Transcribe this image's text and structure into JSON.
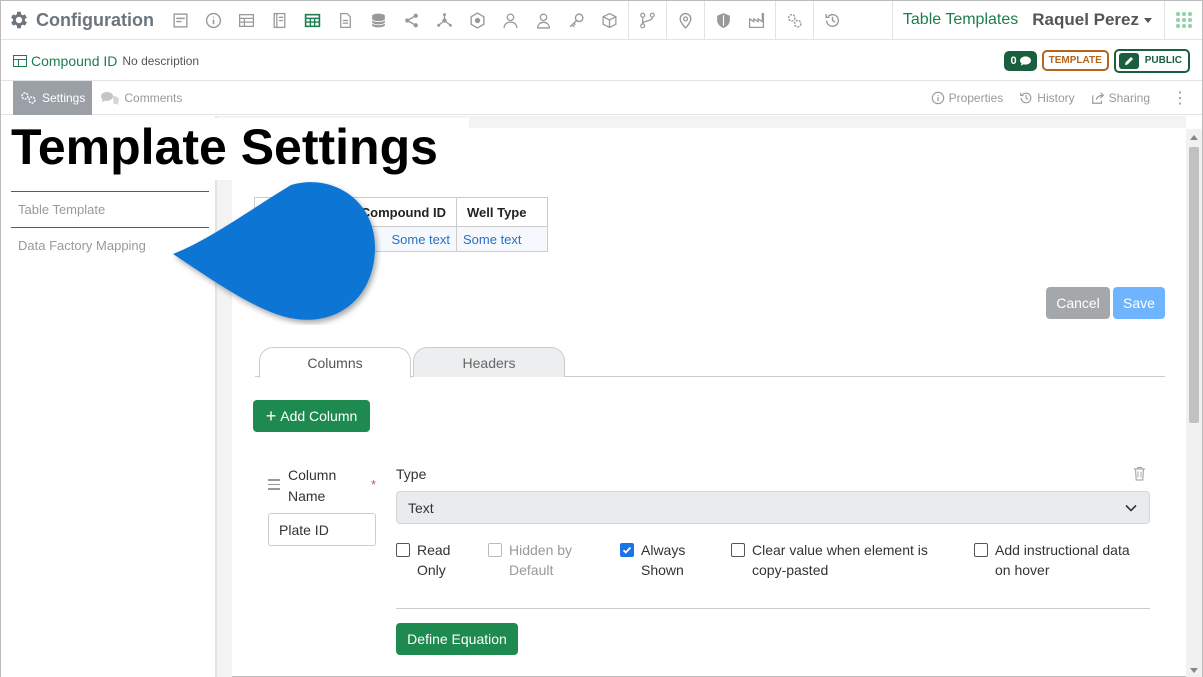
{
  "app": {
    "title": "Configuration",
    "nav_icons": [
      "form-icon",
      "info-icon",
      "table-icon",
      "notebook-icon",
      "table-templates-icon",
      "document-icon",
      "database-icon",
      "share-icon",
      "network-icon",
      "badge-icon",
      "users-icon",
      "user-icon",
      "key-icon",
      "cube-icon",
      "workflow-icon",
      "location-icon",
      "shield-icon",
      "factory-icon",
      "settings-icon",
      "history-icon"
    ],
    "section_link": "Table Templates",
    "user_name": "Raquel Perez"
  },
  "record": {
    "name": "Compound ID",
    "description": "No description",
    "comment_count": "0",
    "template_badge": "TEMPLATE",
    "public_badge": "PUBLIC"
  },
  "tabs": {
    "settings": "Settings",
    "comments": "Comments",
    "properties": "Properties",
    "history": "History",
    "sharing": "Sharing"
  },
  "page": {
    "title": "Template Settings",
    "side_items": [
      "Table Template",
      "Data Factory Mapping"
    ]
  },
  "preview": {
    "headers": [
      "Compound ID",
      "Well Type"
    ],
    "row": [
      "Some text",
      "Some text"
    ]
  },
  "actions": {
    "cancel": "Cancel",
    "save": "Save",
    "add_column": "Add Column",
    "define_equation": "Define Equation"
  },
  "subtabs": {
    "columns": "Columns",
    "headers": "Headers"
  },
  "column_editor": {
    "name_label": "Column Name",
    "required_mark": "*",
    "name_value": "Plate ID",
    "type_label": "Type",
    "type_value": "Text",
    "options": [
      {
        "label": "Read Only",
        "checked": false,
        "disabled": false
      },
      {
        "label": "Hidden by Default",
        "checked": false,
        "disabled": true
      },
      {
        "label": "Always Shown",
        "checked": true,
        "disabled": false
      },
      {
        "label": "Clear value when element is copy-pasted",
        "checked": false,
        "disabled": false
      },
      {
        "label": "Add instructional data on hover",
        "checked": false,
        "disabled": false
      }
    ]
  },
  "colors": {
    "brand_green": "#1e8a4f",
    "dark_green": "#1a5f3d",
    "template_orange": "#b5651d",
    "blob_blue": "#0b74d4"
  }
}
